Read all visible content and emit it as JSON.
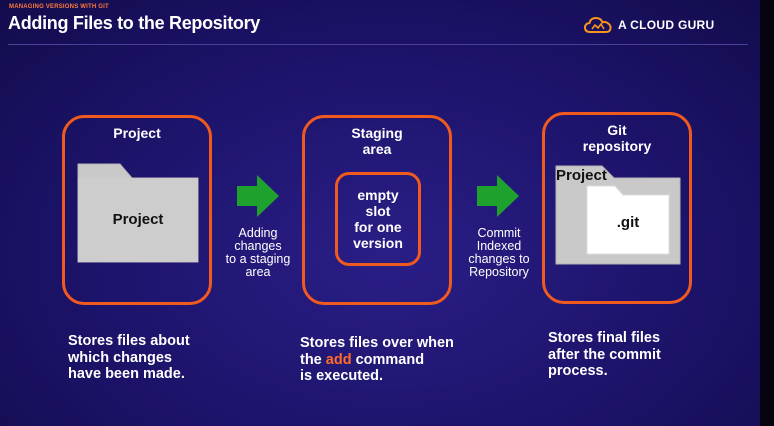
{
  "header": {
    "eyebrow": "MANAGING VERSIONS WITH GIT",
    "title": "Adding Files to the Repository"
  },
  "brand": {
    "name": "A CLOUD GURU",
    "icon": "cloud-icon",
    "color": "#f7931e"
  },
  "colors": {
    "accent": "#f05a1e",
    "arrow": "#1fa12e",
    "folder": "#c9c9c9"
  },
  "stages": {
    "project": {
      "title": "Project",
      "folder_label": "Project",
      "description": "Stores files about\nwhich changes\nhave been made."
    },
    "staging": {
      "title": "Staging\narea",
      "slot_text": "empty\nslot\nfor one\nversion",
      "description_before": "Stores files over when\nthe ",
      "description_highlight": "add",
      "description_after": " command\nis executed."
    },
    "repository": {
      "title": "Git\nrepository",
      "outer_folder_label": "Project",
      "inner_folder_label": ".git",
      "description": "Stores final files\nafter the commit\nprocess."
    }
  },
  "transitions": {
    "add": "Adding\nchanges\nto a staging\narea",
    "commit": "Commit\nIndexed\nchanges to\nRepository"
  }
}
